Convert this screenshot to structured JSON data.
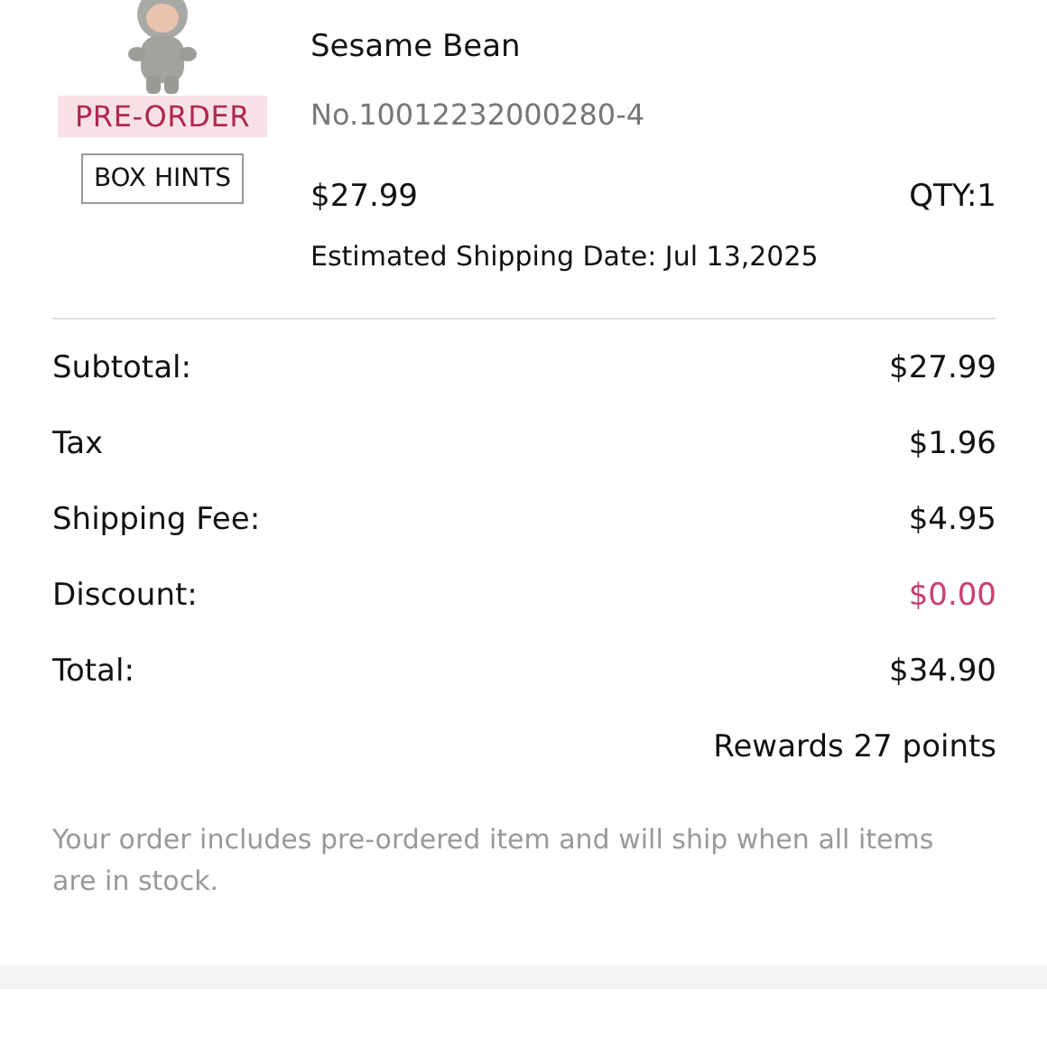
{
  "product": {
    "badge": "PRE-ORDER",
    "hints_button": "BOX HINTS",
    "name": "Sesame Bean",
    "number": "No.10012232000280-4",
    "price": "$27.99",
    "quantity": "QTY:1",
    "shipping_date": "Estimated Shipping Date: Jul 13,2025"
  },
  "summary": [
    {
      "label": "Subtotal:",
      "value": "$27.99",
      "kind": "amount"
    },
    {
      "label": "Tax",
      "value": "$1.96",
      "kind": "amount"
    },
    {
      "label": "Shipping Fee:",
      "value": "$4.95",
      "kind": "amount"
    },
    {
      "label": "Discount:",
      "value": "$0.00",
      "kind": "discount"
    },
    {
      "label": "Total:",
      "value": "$34.90",
      "kind": "amount"
    }
  ],
  "rewards": "Rewards 27 points",
  "note": "Your order includes pre-ordered item and will ship when all items are in stock."
}
